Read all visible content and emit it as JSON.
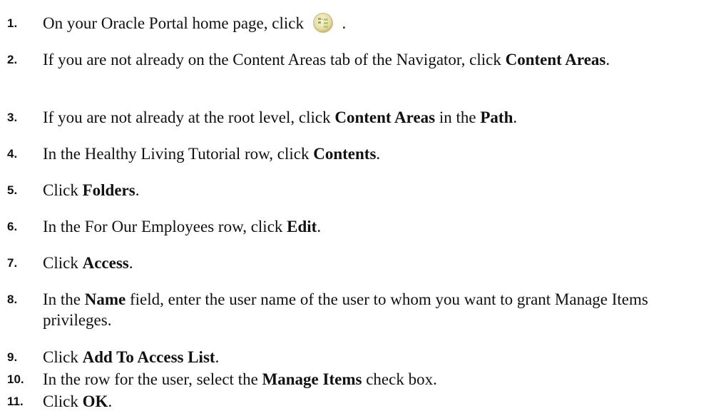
{
  "steps": [
    {
      "num": "1.",
      "parts": [
        {
          "t": "On your Oracle Portal home page, click "
        },
        {
          "icon": "navigator-icon"
        },
        {
          "t": " ."
        }
      ]
    },
    {
      "num": "2.",
      "parts": [
        {
          "t": "If you are not already on the Content Areas tab of the Navigator, click "
        },
        {
          "b": "Content Areas"
        },
        {
          "t": "."
        }
      ]
    },
    {
      "num": "3.",
      "parts": [
        {
          "t": "If you are not already at the root level, click "
        },
        {
          "b": "Content Areas"
        },
        {
          "t": " in the "
        },
        {
          "b": "Path"
        },
        {
          "t": "."
        }
      ]
    },
    {
      "num": "4.",
      "parts": [
        {
          "t": "In the Healthy Living Tutorial row, click "
        },
        {
          "b": "Contents"
        },
        {
          "t": "."
        }
      ]
    },
    {
      "num": "5.",
      "parts": [
        {
          "t": "Click "
        },
        {
          "b": "Folders"
        },
        {
          "t": "."
        }
      ]
    },
    {
      "num": "6.",
      "parts": [
        {
          "t": "In the For Our Employees row, click "
        },
        {
          "b": "Edit"
        },
        {
          "t": "."
        }
      ]
    },
    {
      "num": "7.",
      "parts": [
        {
          "t": "Click "
        },
        {
          "b": "Access"
        },
        {
          "t": "."
        }
      ]
    },
    {
      "num": "8.",
      "parts": [
        {
          "t": "In the "
        },
        {
          "b": "Name"
        },
        {
          "t": " field, enter the user name of the user to whom you want to grant Manage Items privileges."
        }
      ]
    },
    {
      "num": "9.",
      "parts": [
        {
          "t": "Click "
        },
        {
          "b": "Add To Access List"
        },
        {
          "t": "."
        }
      ]
    },
    {
      "num": "10.",
      "parts": [
        {
          "t": "In the row for the user, select the "
        },
        {
          "b": "Manage Items"
        },
        {
          "t": " check box."
        }
      ]
    },
    {
      "num": "11.",
      "parts": [
        {
          "t": "Click "
        },
        {
          "b": "OK"
        },
        {
          "t": "."
        }
      ]
    }
  ]
}
